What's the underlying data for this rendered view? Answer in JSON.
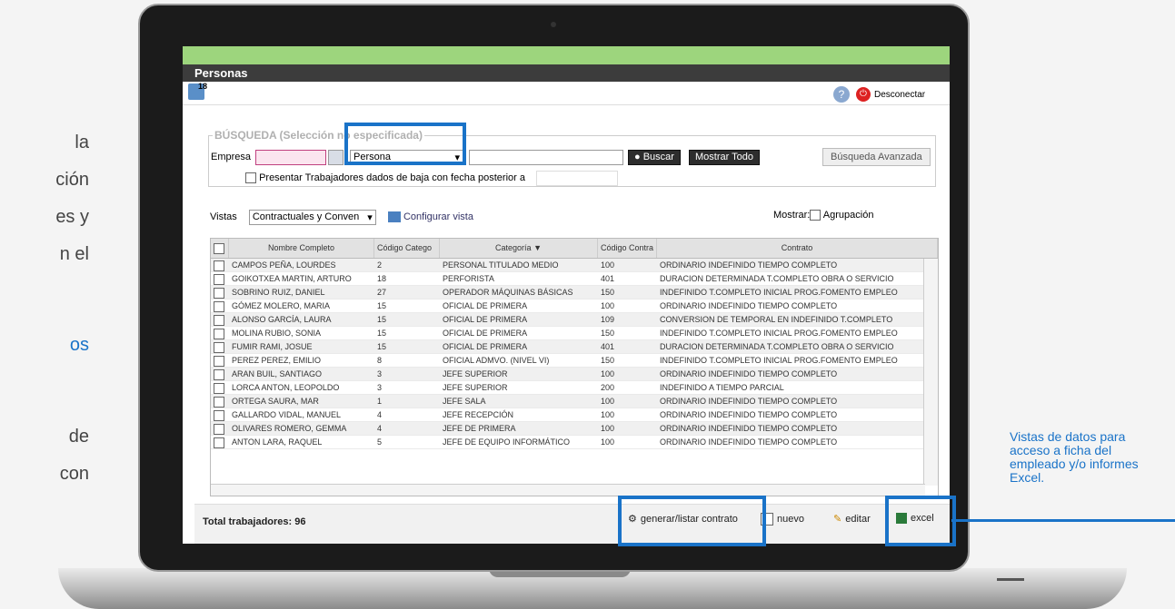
{
  "side_fragments": [
    "la",
    "ción",
    "es y",
    "n el",
    "os",
    "de",
    "con"
  ],
  "app": {
    "title": "Personas",
    "badge": "18",
    "disconnect": "Desconectar"
  },
  "search": {
    "legend": "BÚSQUEDA (Selección no especificada)",
    "empresa_label": "Empresa",
    "persona_select": "Persona",
    "buscar": "Buscar",
    "mostrar_todo": "Mostrar Todo",
    "avanzada": "Búsqueda Avanzada",
    "presentar": "Presentar Trabajadores dados de baja con fecha posterior a"
  },
  "views": {
    "label": "Vistas",
    "selected": "Contractuales y Conven",
    "configure": "Configurar vista",
    "mostrar": "Mostrar:",
    "agrupacion": "Agrupación"
  },
  "table": {
    "headers": [
      "Nombre Completo",
      "Código Catego",
      "Categoría",
      "Código Contra",
      "Contrato"
    ],
    "rows": [
      [
        "CAMPOS PEÑA, LOURDES",
        "2",
        "PERSONAL TITULADO MEDIO",
        "100",
        "ORDINARIO INDEFINIDO TIEMPO COMPLETO"
      ],
      [
        "GOIKOTXEA MARTIN, ARTURO",
        "18",
        "PERFORISTA",
        "401",
        "DURACION DETERMINADA T.COMPLETO OBRA O SERVICIO"
      ],
      [
        "SOBRINO RUIZ, DANIEL",
        "27",
        "OPERADOR MÁQUINAS BÁSICAS",
        "150",
        "INDEFINIDO T.COMPLETO INICIAL PROG.FOMENTO EMPLEO"
      ],
      [
        "GÓMEZ MOLERO, MARIA",
        "15",
        "OFICIAL DE PRIMERA",
        "100",
        "ORDINARIO INDEFINIDO TIEMPO COMPLETO"
      ],
      [
        "ALONSO GARCÍA, LAURA",
        "15",
        "OFICIAL DE PRIMERA",
        "109",
        "CONVERSION DE TEMPORAL EN INDEFINIDO T.COMPLETO"
      ],
      [
        "MOLINA RUBIO, SONIA",
        "15",
        "OFICIAL DE PRIMERA",
        "150",
        "INDEFINIDO T.COMPLETO INICIAL PROG.FOMENTO EMPLEO"
      ],
      [
        "FUMIR RAMI, JOSUE",
        "15",
        "OFICIAL DE PRIMERA",
        "401",
        "DURACION DETERMINADA T.COMPLETO OBRA O SERVICIO"
      ],
      [
        "PEREZ PEREZ, EMILIO",
        "8",
        "OFICIAL ADMVO. (NIVEL VI)",
        "150",
        "INDEFINIDO T.COMPLETO INICIAL PROG.FOMENTO EMPLEO"
      ],
      [
        "ARAN BUIL, SANTIAGO",
        "3",
        "JEFE SUPERIOR",
        "100",
        "ORDINARIO INDEFINIDO TIEMPO COMPLETO"
      ],
      [
        "LORCA ANTON, LEOPOLDO",
        "3",
        "JEFE SUPERIOR",
        "200",
        "INDEFINIDO A TIEMPO PARCIAL"
      ],
      [
        "ORTEGA SAURA, MAR",
        "1",
        "JEFE SALA",
        "100",
        "ORDINARIO INDEFINIDO TIEMPO COMPLETO"
      ],
      [
        "GALLARDO VIDAL, MANUEL",
        "4",
        "JEFE RECEPCIÓN",
        "100",
        "ORDINARIO INDEFINIDO TIEMPO COMPLETO"
      ],
      [
        "OLIVARES ROMERO, GEMMA",
        "4",
        "JEFE DE PRIMERA",
        "100",
        "ORDINARIO INDEFINIDO TIEMPO COMPLETO"
      ],
      [
        "ANTON LARA, RAQUEL",
        "5",
        "JEFE DE EQUIPO INFORMÁTICO",
        "100",
        "ORDINARIO INDEFINIDO TIEMPO COMPLETO"
      ]
    ]
  },
  "footer": {
    "total": "Total trabajadores: 96",
    "generar": "generar/listar contrato",
    "nuevo": "nuevo",
    "editar": "editar",
    "excel": "excel"
  },
  "callout": "Vistas de datos para acceso a ficha del empleado y/o informes Excel.",
  "colors": {
    "accent": "#1a73c8",
    "green": "#9dd57d"
  }
}
